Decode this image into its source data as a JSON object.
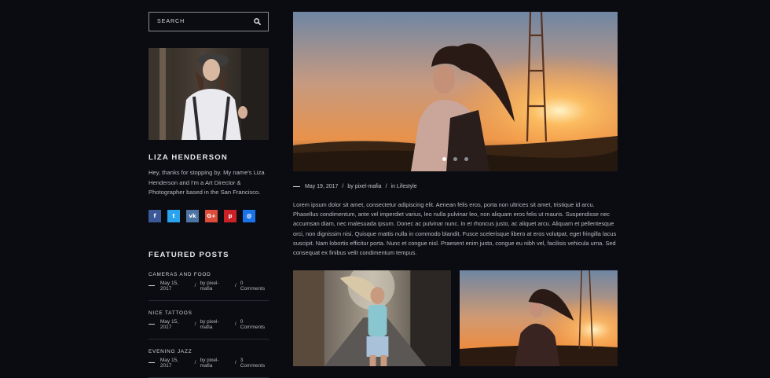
{
  "search": {
    "placeholder": "SEARCH",
    "icon": "search-icon"
  },
  "author": {
    "name": "LIZA HENDERSON",
    "bio": "Hey, thanks for stopping by. My name's Liza Henderson and I'm a Art Director & Photographer based in the San Francisco."
  },
  "socials": [
    {
      "name": "facebook-icon",
      "glyph": "f",
      "color": "#3b5998"
    },
    {
      "name": "twitter-icon",
      "glyph": "t",
      "color": "#2aa3ef"
    },
    {
      "name": "vk-icon",
      "glyph": "vk",
      "color": "#4c75a3"
    },
    {
      "name": "google-plus-icon",
      "glyph": "G+",
      "color": "#dd4b39"
    },
    {
      "name": "pinterest-icon",
      "glyph": "p",
      "color": "#cb2027"
    },
    {
      "name": "email-icon",
      "glyph": "@",
      "color": "#1a73e8"
    }
  ],
  "featured": {
    "title": "FEATURED POSTS",
    "posts": [
      {
        "title": "CAMERAS AND FOOD",
        "date": "May 15, 2017",
        "author": "by pixel-mafia",
        "comments": "0 Comments"
      },
      {
        "title": "NICE TATTOOS",
        "date": "May 15, 2017",
        "author": "by pixel-mafia",
        "comments": "0 Comments"
      },
      {
        "title": "EVENING JAZZ",
        "date": "May 15, 2017",
        "author": "by pixel-mafia",
        "comments": "3 Comments"
      }
    ]
  },
  "post": {
    "date": "May 19, 2017",
    "author": "by pixel-mafia",
    "category_prefix": "in",
    "category": "Lifestyle",
    "separator": "/",
    "excerpt": "Lorem ipsum dolor sit amet, consectetur adipiscing elit. Aenean felis eros, porta non ultrices sit amet, tristique id arcu. Phasellus condimentum, ante vel imperdiet varius, leo nulla pulvinar leo, non aliquam eros felis ut mauris. Suspendisse nec accumsan diam, nec malesuada ipsum. Donec ac pulvinar nunc. In et rhoncus justo, ac aliquet arcu. Aliquam et pellentesque orci, non dignissim nisi. Quisque mattis nulla in commodo blandit. Fusce scelerisque libero at eros volutpat, eget fringilla lacus suscipit. Nam lobortis efficitur porta. Nunc et congue nisl. Praesent enim justo, congue eu nibh vel, facilisis vehicula urna. Sed consequat ex finibus velit condimentum tempus.",
    "slider": {
      "slides": 3,
      "active": 1
    }
  }
}
